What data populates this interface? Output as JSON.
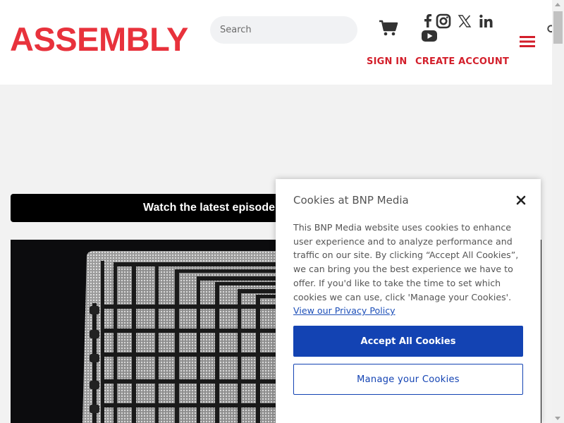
{
  "header": {
    "logo_text": "ASSEMBLY",
    "search_placeholder": "Search",
    "sign_in": "SIGN IN",
    "create_account": "CREATE ACCOUNT",
    "icons": [
      "search-icon",
      "cart-icon",
      "facebook-icon",
      "instagram-icon",
      "x-icon",
      "linkedin-icon",
      "youtube-icon",
      "menu-icon"
    ]
  },
  "banner": {
    "text": "Watch the latest episode"
  },
  "cookie_modal": {
    "title": "Cookies at BNP Media",
    "body": "This BNP Media website uses cookies to enhance user experience and to analyze performance and traffic on our site. By clicking “Accept All Cookies”, we can bring you the best experience we have to offer. If you'd like to take the time to set which cookies we can use, click 'Manage your Cookies'.",
    "privacy_link": "View our Privacy Policy",
    "accept_label": "Accept All Cookies",
    "manage_label": "Manage your Cookies"
  },
  "colors": {
    "brand_red": "#e8323c",
    "link_red": "#d31f2b",
    "primary_blue": "#1343b3",
    "banner_black": "#000000"
  }
}
